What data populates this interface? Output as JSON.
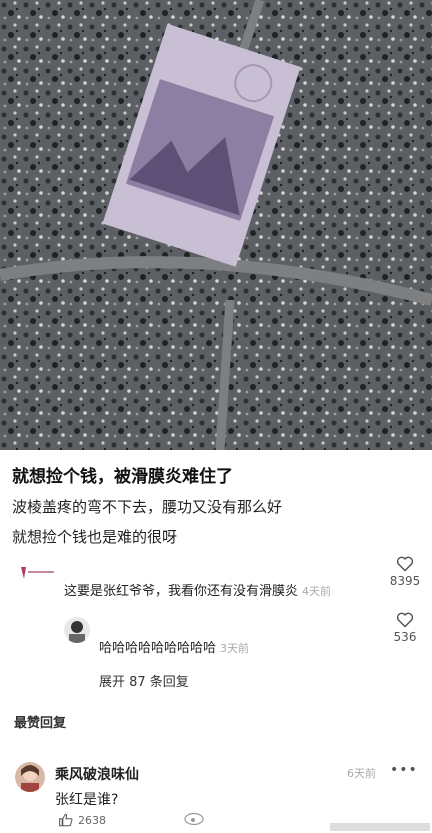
{
  "post": {
    "title": "就想捡个钱，被滑膜炎难住了",
    "line1": "波棱盖疼的弯不下去，腰功又没有那么好",
    "line2": "就想捡个钱也是难的很呀"
  },
  "comments": [
    {
      "text": "这要是张红爷爷，我看你还有没有滑膜炎",
      "time": "4天前",
      "likes": "8395"
    },
    {
      "text": "哈哈哈哈哈哈哈哈哈",
      "time": "3天前",
      "likes": "536"
    }
  ],
  "expand_label": "展开 87 条回复",
  "section_label": "最赞回复",
  "top_reply": {
    "user": "乘风破浪味仙",
    "text": "张红是谁?",
    "time": "6天前",
    "likes": "2638"
  },
  "colors": {
    "heart": "#555555",
    "stone": "#5c5f63"
  }
}
